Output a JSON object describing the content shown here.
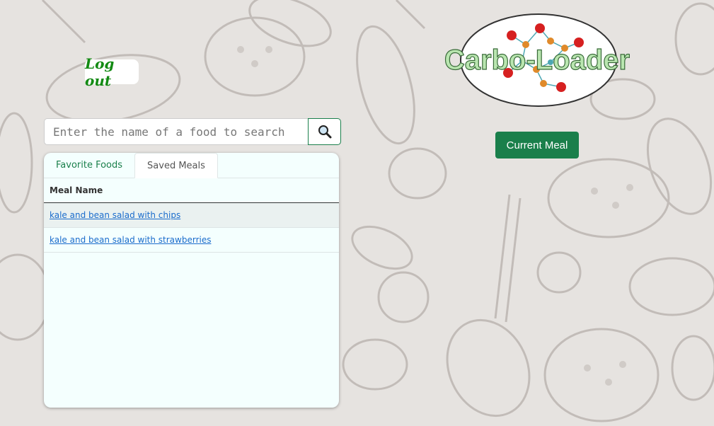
{
  "header": {
    "logout_label": "Log out",
    "logo_text": "Carbo-Loader",
    "current_meal_label": "Current Meal"
  },
  "search": {
    "placeholder": "Enter the name of a food to search",
    "button_icon": "magnifier-icon"
  },
  "tabs": [
    {
      "label": "Favorite Foods",
      "active": false
    },
    {
      "label": "Saved Meals",
      "active": true
    }
  ],
  "table": {
    "column_header": "Meal Name",
    "rows": [
      {
        "name": "kale and bean salad with chips"
      },
      {
        "name": "kale and bean salad with strawberries"
      }
    ]
  },
  "colors": {
    "accent": "#1a7f4b",
    "logout_text": "#138a13",
    "link": "#1a6ccc",
    "background": "#e6e3e0",
    "panel": "#f4fffe"
  }
}
